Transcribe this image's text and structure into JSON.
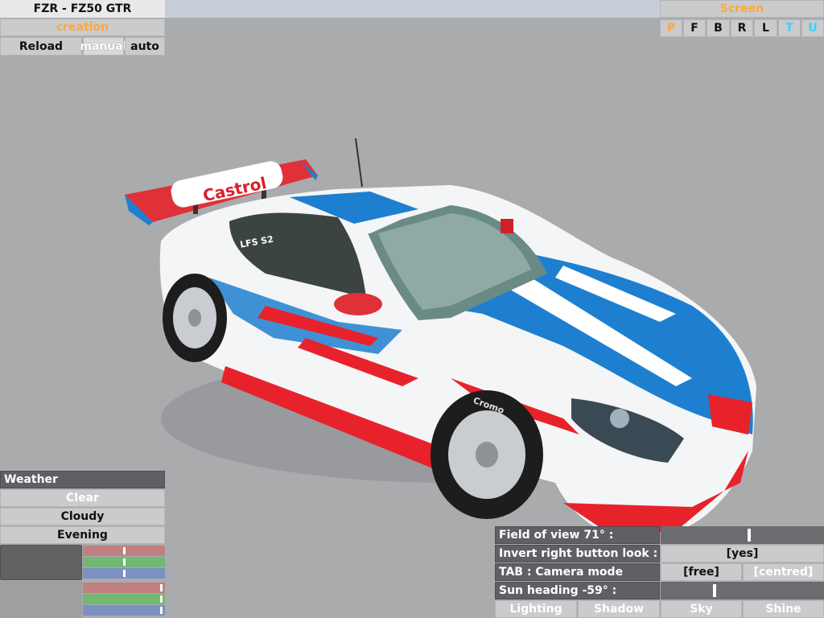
{
  "header": {
    "car_title": "FZR - FZ50 GTR",
    "mode_label": "creation",
    "buttons": {
      "reload": "Reload",
      "manual": "manual",
      "auto": "auto"
    }
  },
  "screen": {
    "title": "Screen",
    "tabs": [
      "P",
      "F",
      "B",
      "R",
      "L",
      "T",
      "U"
    ]
  },
  "weather": {
    "title": "Weather",
    "options": [
      "Clear",
      "Cloudy",
      "Evening"
    ]
  },
  "car": {
    "wing_sponsor": "Castrol",
    "window_text": "LFS S2",
    "tyre_brand": "Cromo"
  },
  "camera": {
    "fov_label": "Field of view 71° :",
    "fov_value": 71,
    "invert_label": "Invert right button look :",
    "invert_value": "[yes]",
    "tab_label": "TAB : Camera mode",
    "free_label": "[free]",
    "centred_label": "[centred]",
    "sun_label": "Sun heading -59° :",
    "sun_value": -59,
    "bottom_tabs": [
      "Lighting",
      "Shadow",
      "Sky",
      "Shine"
    ]
  },
  "colors": {
    "background": "#a9abad",
    "accent_orange": "#ffa838",
    "accent_cyan": "#38d2ff",
    "car_blue": "#1e7fd0",
    "car_red": "#e8222b"
  }
}
